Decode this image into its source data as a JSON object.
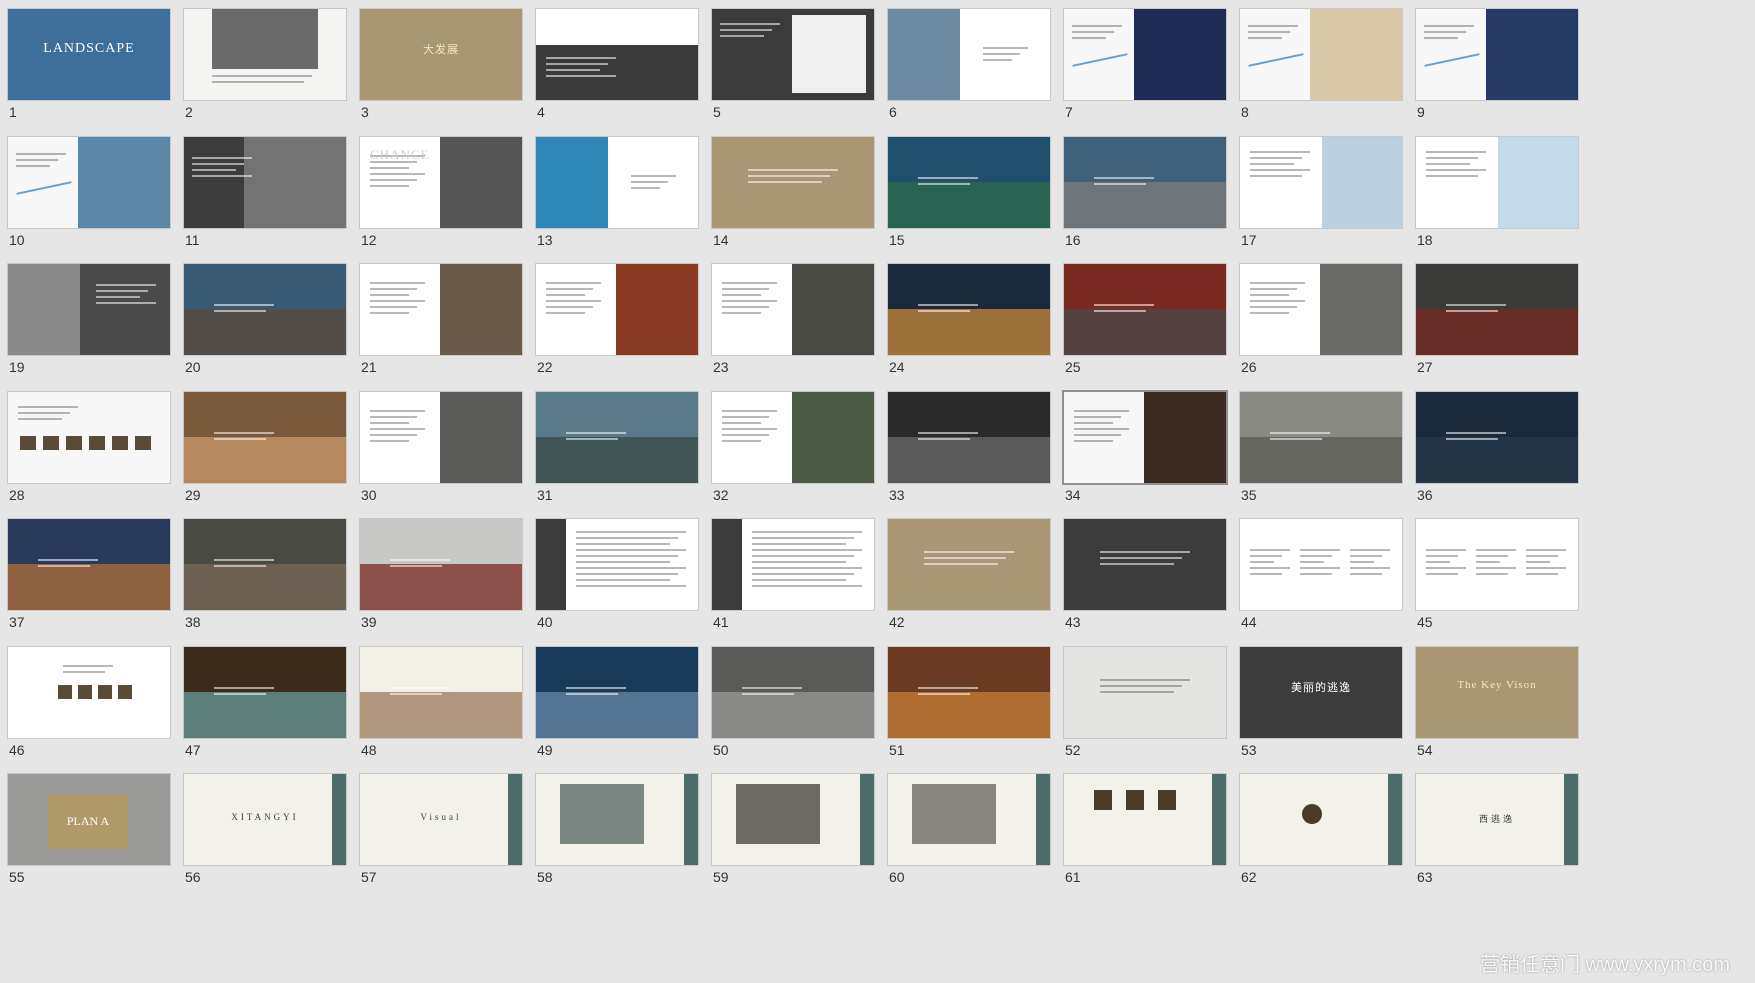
{
  "watermark": "营销任意门 www.yxrym.com",
  "selected": 34,
  "slides": [
    {
      "n": 1,
      "bg": "#3d6f9a",
      "kind": "title",
      "text": "LANDSCAPE"
    },
    {
      "n": 2,
      "bg": "#f4f4f2",
      "kind": "photo-top",
      "accent": "#6a6a6a"
    },
    {
      "n": 3,
      "bg": "#a89675",
      "kind": "title-small",
      "text": "大发展"
    },
    {
      "n": 4,
      "bg": "#ffffff",
      "kind": "split-dark",
      "accent": "#3a3a3a"
    },
    {
      "n": 5,
      "bg": "#3b3b3b",
      "kind": "dark-doc",
      "text": "OVERARCHING RECORD"
    },
    {
      "n": 6,
      "bg": "#ffffff",
      "kind": "photo-left",
      "accent": "#6d8aa0"
    },
    {
      "n": 7,
      "bg": "#f7f7f7",
      "kind": "chart-poster",
      "accent": "#1f2a55"
    },
    {
      "n": 8,
      "bg": "#f7f7f7",
      "kind": "chart-poster",
      "accent": "#d8c7a8"
    },
    {
      "n": 9,
      "bg": "#f7f7f7",
      "kind": "chart-poster",
      "accent": "#263a66"
    },
    {
      "n": 10,
      "bg": "#f7f7f7",
      "kind": "chart-poster",
      "accent": "#5b88a8"
    },
    {
      "n": 11,
      "bg": "#3c3c3c",
      "kind": "dark-map",
      "accent": "#d9d9d9"
    },
    {
      "n": 12,
      "bg": "#ffffff",
      "kind": "photo-right",
      "accent": "#555555",
      "text": "CHANCE"
    },
    {
      "n": 13,
      "bg": "#ffffff",
      "kind": "photo-left",
      "accent": "#2f86b8"
    },
    {
      "n": 14,
      "bg": "#a89675",
      "kind": "text-center"
    },
    {
      "n": 15,
      "bg": "#1f4f6b",
      "kind": "photo-full",
      "accent": "#2d6b4a"
    },
    {
      "n": 16,
      "bg": "#41607a",
      "kind": "photo-full",
      "accent": "#7c7c7c"
    },
    {
      "n": 17,
      "bg": "#ffffff",
      "kind": "map-right",
      "accent": "#8fb0cc"
    },
    {
      "n": 18,
      "bg": "#ffffff",
      "kind": "map-right",
      "accent": "#9fc2d8"
    },
    {
      "n": 19,
      "bg": "#4a4a4a",
      "kind": "map-left",
      "accent": "#ffffff"
    },
    {
      "n": 20,
      "bg": "#3a5a74",
      "kind": "photo-full",
      "accent": "#5b4a3a"
    },
    {
      "n": 21,
      "bg": "#ffffff",
      "kind": "photo-right",
      "accent": "#6a5a4a"
    },
    {
      "n": 22,
      "bg": "#ffffff",
      "kind": "photo-right",
      "accent": "#8a3a22"
    },
    {
      "n": 23,
      "bg": "#ffffff",
      "kind": "photo-right",
      "accent": "#4a4a44"
    },
    {
      "n": 24,
      "bg": "#1a2a3c",
      "kind": "photo-full",
      "accent": "#c98a3a"
    },
    {
      "n": 25,
      "bg": "#7a2a22",
      "kind": "photo-full",
      "accent": "#4a4a4a"
    },
    {
      "n": 26,
      "bg": "#ffffff",
      "kind": "photo-right",
      "accent": "#6a6a66"
    },
    {
      "n": 27,
      "bg": "#3a3a38",
      "kind": "photo-full",
      "accent": "#7a2a22"
    },
    {
      "n": 28,
      "bg": "#f7f7f7",
      "kind": "gallery",
      "accent": "#5a4a3a"
    },
    {
      "n": 29,
      "bg": "#7a5a3a",
      "kind": "photo-full",
      "accent": "#c99a6a"
    },
    {
      "n": 30,
      "bg": "#ffffff",
      "kind": "photo-right",
      "accent": "#5a5a58"
    },
    {
      "n": 31,
      "bg": "#5a7a8a",
      "kind": "photo-full",
      "accent": "#3a4a44"
    },
    {
      "n": 32,
      "bg": "#ffffff",
      "kind": "photo-right",
      "accent": "#4a5a44"
    },
    {
      "n": 33,
      "bg": "#2a2a2a",
      "kind": "photo-full",
      "accent": "#6a6a6a"
    },
    {
      "n": 34,
      "bg": "#f7f7f7",
      "kind": "photo-right",
      "accent": "#3a2a22"
    },
    {
      "n": 35,
      "bg": "#8a8a84",
      "kind": "photo-full",
      "accent": "#5a5a54"
    },
    {
      "n": 36,
      "bg": "#1a2a3c",
      "kind": "photo-full",
      "accent": "#2a3a4c"
    },
    {
      "n": 37,
      "bg": "#2a3a5a",
      "kind": "photo-full",
      "accent": "#b0703a"
    },
    {
      "n": 38,
      "bg": "#4a4a44",
      "kind": "photo-full",
      "accent": "#7a6a5a"
    },
    {
      "n": 39,
      "bg": "#c8c8c6",
      "kind": "photo-full",
      "accent": "#7a2a22"
    },
    {
      "n": 40,
      "bg": "#ffffff",
      "kind": "text-dark-left",
      "accent": "#3c3c3c"
    },
    {
      "n": 41,
      "bg": "#ffffff",
      "kind": "text-dark-left",
      "accent": "#3c3c3c"
    },
    {
      "n": 42,
      "bg": "#a89675",
      "kind": "text-center"
    },
    {
      "n": 43,
      "bg": "#3c3c3c",
      "kind": "text-center"
    },
    {
      "n": 44,
      "bg": "#ffffff",
      "kind": "text-light"
    },
    {
      "n": 45,
      "bg": "#ffffff",
      "kind": "text-light"
    },
    {
      "n": 46,
      "bg": "#ffffff",
      "kind": "org-chart",
      "accent": "#5a4a3a"
    },
    {
      "n": 47,
      "bg": "#3a2a1a",
      "kind": "photo-full",
      "accent": "#6a9a9a"
    },
    {
      "n": 48,
      "bg": "#f2efe6",
      "kind": "photo-full",
      "accent": "#9a7a5a"
    },
    {
      "n": 49,
      "bg": "#1a3a5a",
      "kind": "photo-full",
      "accent": "#6a8aa8"
    },
    {
      "n": 50,
      "bg": "#5a5a58",
      "kind": "photo-full",
      "accent": "#9a9a98"
    },
    {
      "n": 51,
      "bg": "#6a3a22",
      "kind": "photo-full",
      "accent": "#c9803a"
    },
    {
      "n": 52,
      "bg": "#e4e4e2",
      "kind": "text-center-light"
    },
    {
      "n": 53,
      "bg": "#3c3c3c",
      "kind": "title-small",
      "text": "美丽的逃逸"
    },
    {
      "n": 54,
      "bg": "#a89675",
      "kind": "title-small",
      "text": "The Key Vison"
    },
    {
      "n": 55,
      "bg": "#9a9a98",
      "kind": "plan",
      "text": "PLAN A"
    },
    {
      "n": 56,
      "bg": "#f2f2ea",
      "kind": "cream",
      "text": "XITANGYI"
    },
    {
      "n": 57,
      "bg": "#f2f2ea",
      "kind": "cream",
      "text": "Visual"
    },
    {
      "n": 58,
      "bg": "#f2f2ea",
      "kind": "cream-photo",
      "accent": "#5a6a68"
    },
    {
      "n": 59,
      "bg": "#f2f2ea",
      "kind": "cream-photo",
      "accent": "#4a4a44"
    },
    {
      "n": 60,
      "bg": "#f2f2ea",
      "kind": "cream-photo",
      "accent": "#6a6a64"
    },
    {
      "n": 61,
      "bg": "#f2f2ea",
      "kind": "cream-icons",
      "accent": "#4a3a2a"
    },
    {
      "n": 62,
      "bg": "#f2f2ea",
      "kind": "cream-logo",
      "accent": "#4a3a2a"
    },
    {
      "n": 63,
      "bg": "#f2f2ea",
      "kind": "cream",
      "text": "西逃逸"
    }
  ]
}
